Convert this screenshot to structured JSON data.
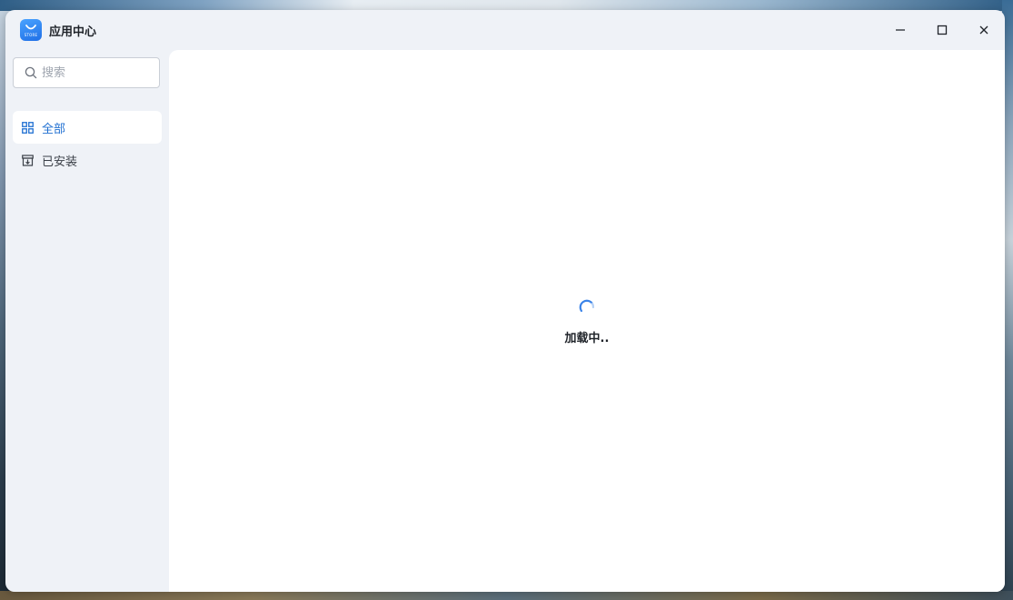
{
  "window": {
    "title": "应用中心",
    "logo_text": "STORE",
    "controls": {
      "minimize": "minimize",
      "maximize": "maximize",
      "close": "close"
    }
  },
  "sidebar": {
    "search": {
      "placeholder": "搜索",
      "value": ""
    },
    "items": [
      {
        "label": "全部",
        "icon": "grid-icon",
        "active": true
      },
      {
        "label": "已安装",
        "icon": "installed-box-icon",
        "active": false
      }
    ]
  },
  "main": {
    "status": {
      "text": "加载中..",
      "icon": "loading-spinner-icon"
    }
  },
  "colors": {
    "accent": "#1f6fd1",
    "sidebar_bg": "#eff2f7",
    "content_bg": "#ffffff",
    "logo": "#2f86f2"
  }
}
